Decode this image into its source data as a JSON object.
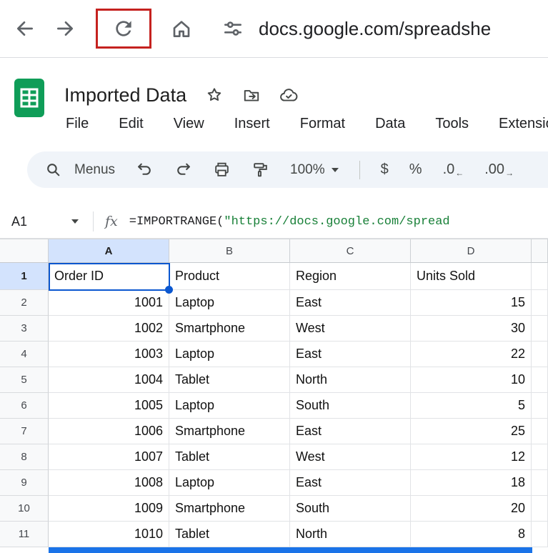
{
  "browser": {
    "url": "docs.google.com/spreadshe",
    "icons": {
      "back": "←",
      "forward": "→",
      "reload": "⟳",
      "home": "⌂",
      "site_settings": "tune-sliders"
    },
    "reload_highlight_color": "#c5221f"
  },
  "header": {
    "title": "Imported Data",
    "icons": {
      "star": "☆",
      "move": "folder-arrow",
      "cloud": "cloud-check"
    },
    "menus": [
      "File",
      "Edit",
      "View",
      "Insert",
      "Format",
      "Data",
      "Tools",
      "Extensions"
    ]
  },
  "toolbar": {
    "menus_label": "Menus",
    "icons": {
      "search": "magnifier",
      "undo": "↶",
      "redo": "↷",
      "print": "printer",
      "paint_format": "paint-roller"
    },
    "zoom": "100%",
    "currency": "$",
    "percent": "%",
    "decrease_decimal": ".0",
    "decrease_decimal_arrow": "←",
    "increase_decimal": ".00",
    "increase_decimal_arrow": "→"
  },
  "formula_bar": {
    "cell_ref": "A1",
    "fx_label": "fx",
    "prefix": "=IMPORTRANGE(",
    "string": "\"https://docs.google.com/spread"
  },
  "grid": {
    "selected_cell": "A1",
    "columns": [
      "A",
      "B",
      "C",
      "D"
    ],
    "rows": [
      [
        "Order ID",
        "Product",
        "Region",
        "Units Sold"
      ],
      [
        "1001",
        "Laptop",
        "East",
        "15"
      ],
      [
        "1002",
        "Smartphone",
        "West",
        "30"
      ],
      [
        "1003",
        "Laptop",
        "East",
        "22"
      ],
      [
        "1004",
        "Tablet",
        "North",
        "10"
      ],
      [
        "1005",
        "Laptop",
        "South",
        "5"
      ],
      [
        "1006",
        "Smartphone",
        "East",
        "25"
      ],
      [
        "1007",
        "Tablet",
        "West",
        "12"
      ],
      [
        "1008",
        "Laptop",
        "East",
        "18"
      ],
      [
        "1009",
        "Smartphone",
        "South",
        "20"
      ],
      [
        "1010",
        "Tablet",
        "North",
        "8"
      ]
    ]
  },
  "colors": {
    "selection_accent": "#0b57d0",
    "header_highlight": "#d3e3fd",
    "range_bar_blue": "#1a73e8",
    "logo_green": "#0f9d58",
    "formula_string_green": "#188038",
    "reload_box_red": "#c5221f"
  }
}
